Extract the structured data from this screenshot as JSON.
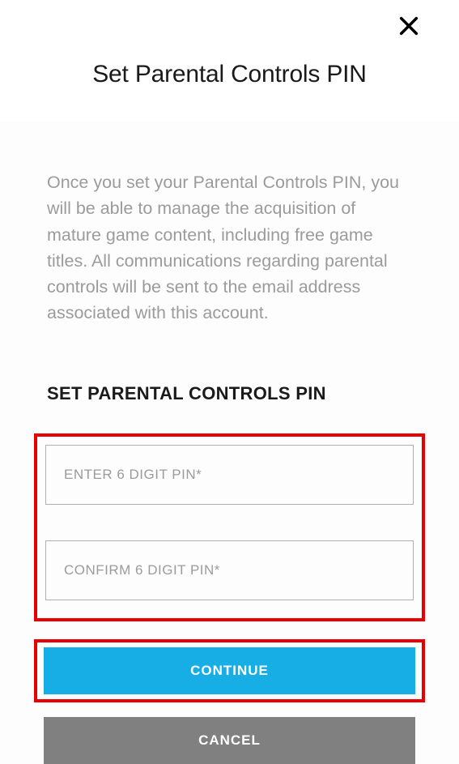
{
  "header": {
    "title": "Set Parental Controls PIN"
  },
  "content": {
    "description": "Once you set your Parental Controls PIN, you will be able to manage the acquisition of mature game content, including free game titles. All communications regarding parental controls will be sent to the email address associated with this account.",
    "section_label": "SET PARENTAL CONTROLS PIN",
    "enter_pin_placeholder": "ENTER 6 DIGIT PIN*",
    "confirm_pin_placeholder": "CONFIRM 6 DIGIT PIN*",
    "enter_pin_value": "",
    "confirm_pin_value": ""
  },
  "buttons": {
    "continue_label": "CONTINUE",
    "cancel_label": "CANCEL"
  },
  "highlights": {
    "inputs_highlighted": true,
    "continue_highlighted": true
  }
}
